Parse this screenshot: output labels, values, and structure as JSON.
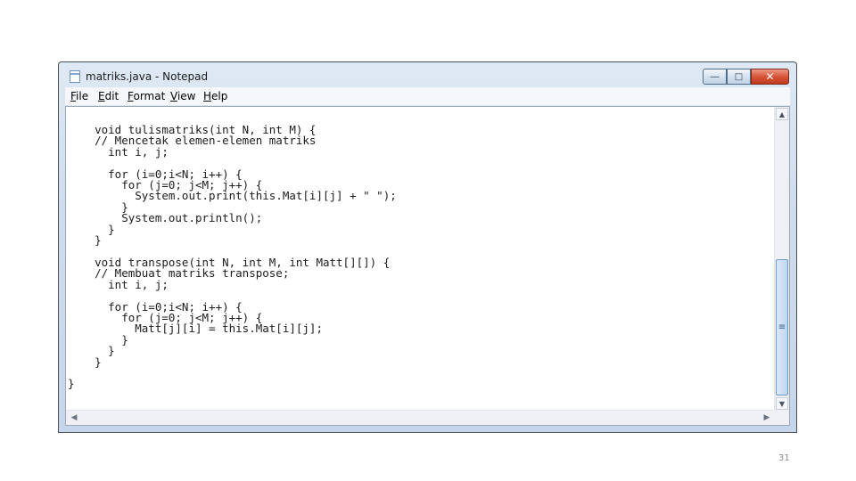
{
  "window": {
    "title": "matriks.java - Notepad",
    "icons": {
      "app": "notepad-icon",
      "minimize": "minimize-icon",
      "maximize": "maximize-icon",
      "close": "close-icon"
    }
  },
  "menubar": {
    "items": [
      {
        "label": "File"
      },
      {
        "label": "Edit"
      },
      {
        "label": "Format"
      },
      {
        "label": "View"
      },
      {
        "label": "Help"
      }
    ]
  },
  "editor": {
    "code": "    void tulismatriks(int N, int M) {\n    // Mencetak elemen-elemen matriks\n      int i, j;\n\n      for (i=0;i<N; i++) {\n        for (j=0; j<M; j++) {\n          System.out.print(this.Mat[i][j] + \" \");\n        }\n        System.out.println();\n      }\n    }\n\n    void transpose(int N, int M, int Matt[][]) {\n    // Membuat matriks transpose;\n      int i, j;\n\n      for (i=0;i<N; i++) {\n        for (j=0; j<M; j++) {\n          Matt[j][i] = this.Mat[i][j];\n        }\n      }\n    }\n\n}"
  },
  "scrollbars": {
    "vertical_position": 0.67,
    "icons": {
      "up": "scroll-up-arrow-icon",
      "down": "scroll-down-arrow-icon",
      "left": "scroll-left-arrow-icon",
      "right": "scroll-right-arrow-icon",
      "grip": "scroll-grip-icon"
    }
  },
  "slide": {
    "page_number": "31"
  }
}
